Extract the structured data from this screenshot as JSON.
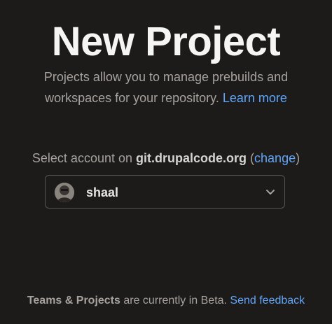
{
  "title": "New Project",
  "description": {
    "text": "Projects allow you to manage prebuilds and workspaces for your repository.",
    "learn_more": "Learn more"
  },
  "account_select": {
    "prefix": "Select account on ",
    "host": "git.drupalcode.org",
    "open_paren": " (",
    "change_label": "change",
    "close_paren": ")"
  },
  "dropdown": {
    "selected_account": "shaal",
    "icon": "chevron-down-icon"
  },
  "footer": {
    "strong": "Teams & Projects",
    "text": " are currently in Beta. ",
    "feedback_label": "Send feedback"
  },
  "colors": {
    "background": "#1c1b1a",
    "title": "#f5f5f4",
    "muted_text": "#a8a29e",
    "link": "#60a5fa",
    "dropdown_border": "#57534e"
  }
}
